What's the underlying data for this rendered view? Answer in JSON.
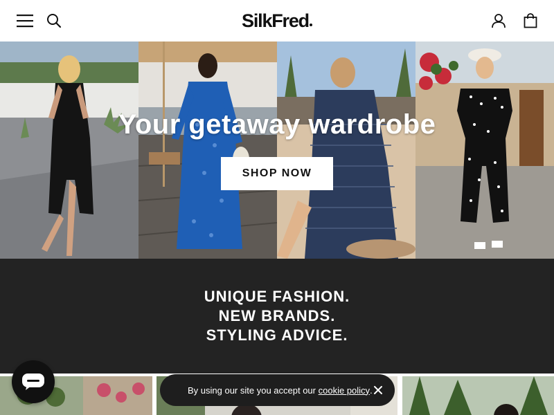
{
  "header": {
    "logo": "SilkFred",
    "menu_icon": "hamburger-menu-icon",
    "search_icon": "search-icon",
    "account_icon": "user-account-icon",
    "bag_icon": "shopping-bag-icon"
  },
  "hero": {
    "title": "Your getaway wardrobe",
    "cta": "SHOP NOW",
    "panels": [
      {
        "name": "black halter dress"
      },
      {
        "name": "blue printed maxi dress"
      },
      {
        "name": "navy striped co-ord"
      },
      {
        "name": "polka dot jumpsuit"
      }
    ]
  },
  "band": {
    "lines": [
      "UNIQUE FASHION.",
      "NEW BRANDS.",
      "STYLING ADVICE."
    ]
  },
  "cookie": {
    "text": "By using our site you accept our ",
    "link": "cookie policy",
    "suffix": "."
  },
  "chat": {
    "icon": "chat-bubble-icon"
  },
  "colors": {
    "band_bg": "#232323",
    "cookie_bg": "#1e1e1e",
    "chat_bg": "#111111"
  }
}
